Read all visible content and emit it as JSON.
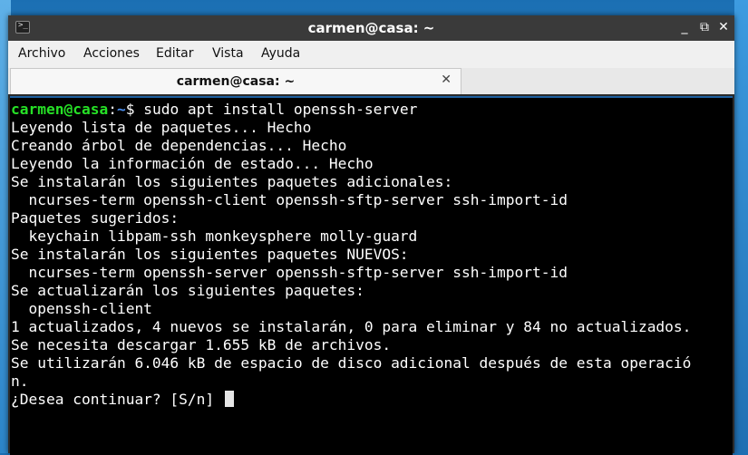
{
  "window": {
    "title": "carmen@casa: ~"
  },
  "window_controls": {
    "minimize": "_",
    "maximize": "⧉",
    "close": "✕"
  },
  "menu": [
    "Archivo",
    "Acciones",
    "Editar",
    "Vista",
    "Ayuda"
  ],
  "tab": {
    "label": "carmen@casa: ~",
    "close": "✕"
  },
  "terminal": {
    "prompt_user": "carmen@casa",
    "prompt_sep": ":",
    "prompt_path": "~",
    "prompt_symbol": "$ ",
    "command": "sudo apt install openssh-server",
    "output": [
      "Leyendo lista de paquetes... Hecho",
      "Creando árbol de dependencias... Hecho",
      "Leyendo la información de estado... Hecho",
      "Se instalarán los siguientes paquetes adicionales:",
      "  ncurses-term openssh-client openssh-sftp-server ssh-import-id",
      "Paquetes sugeridos:",
      "  keychain libpam-ssh monkeysphere molly-guard",
      "Se instalarán los siguientes paquetes NUEVOS:",
      "  ncurses-term openssh-server openssh-sftp-server ssh-import-id",
      "Se actualizarán los siguientes paquetes:",
      "  openssh-client",
      "1 actualizados, 4 nuevos se instalarán, 0 para eliminar y 84 no actualizados.",
      "Se necesita descargar 1.655 kB de archivos.",
      "Se utilizarán 6.046 kB de espacio de disco adicional después de esta operació",
      "n."
    ],
    "question": "¿Desea continuar? [S/n] "
  },
  "colors": {
    "prompt_user": "#26e026",
    "prompt_path": "#4a8ef0",
    "terminal_bg": "#000000",
    "text": "#ffffff"
  }
}
